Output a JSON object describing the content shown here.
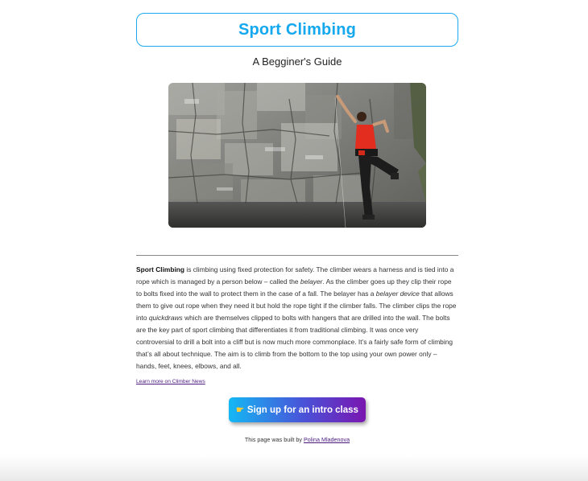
{
  "header": {
    "title": "Sport Climbing",
    "subtitle": "A Begginer's Guide"
  },
  "colors": {
    "accent": "#14a8ee",
    "button_gradient_start": "#14b8f4",
    "button_gradient_end": "#7a16b0",
    "link": "#4a1a80"
  },
  "article": {
    "s1_bold": "Sport Climbing",
    "s2": " is climbing using fixed protection for safety. The climber wears a harness and is tied into a rope which is managed by a person below – called the ",
    "s3_em": "belayer",
    "s4": ". As the climber goes up they clip their rope to bolts fixed into the wall to protect them in the case of a fall. The belayer has a ",
    "s5_em": "belayer device",
    "s6": " that allows them to give out rope when they need it but hold the rope tight if the climber falls. The climber clips the rope into ",
    "s7_em": "quickdraws",
    "s8": " which are themselves clipped to bolts with hangers that are drilled into the wall. The bolts are the key part of sport climbing that differentiates it from traditional climbing. It was once very controversial to drill a bolt into a cliff but is now much more commonplace. It’s a fairly safe form of climbing that’s all about technique. The aim is to climb from the bottom to the top using your own power only – hands, feet, knees, elbows, and all."
  },
  "links": {
    "learn_more": "Learn more on Climber News"
  },
  "cta": {
    "icon": "pointing-hand-icon",
    "label": "Sign up for an intro class"
  },
  "footer": {
    "prefix": "This page was built by ",
    "author": "Polina Mladenova"
  }
}
